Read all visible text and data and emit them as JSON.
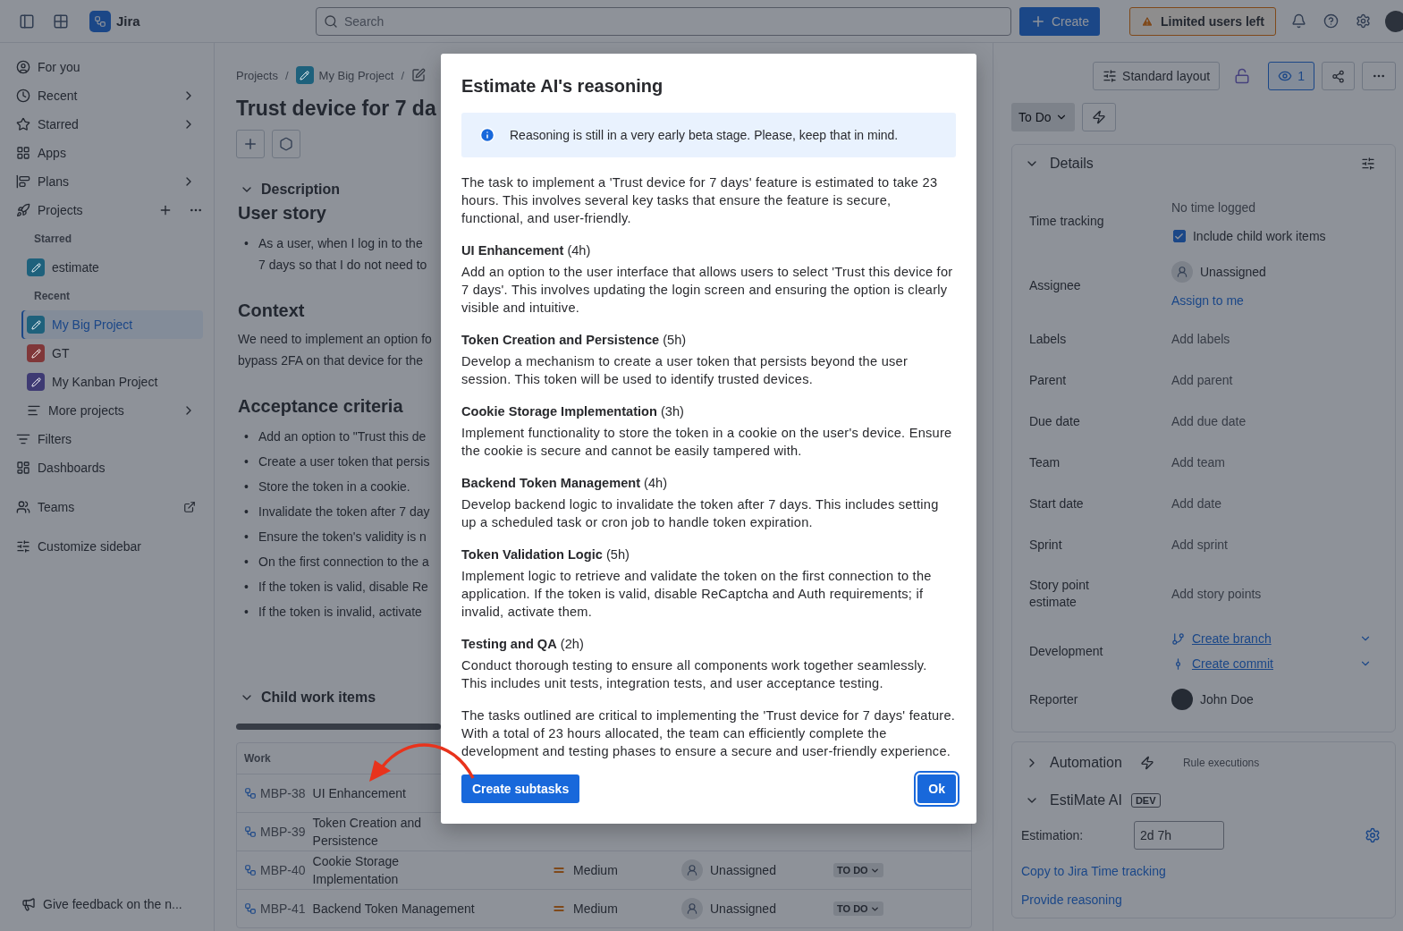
{
  "topbar": {
    "app_name": "Jira",
    "search": {
      "placeholder": "Search"
    },
    "create_button": "Create",
    "warning_button": "Limited users left"
  },
  "sidebar": {
    "items": [
      {
        "kind": "link",
        "label": "For you",
        "chevron": false,
        "selected": false
      },
      {
        "kind": "link",
        "label": "Recent",
        "chevron": true,
        "selected": false
      },
      {
        "kind": "link",
        "label": "Starred",
        "chevron": true,
        "selected": false
      },
      {
        "kind": "link",
        "label": "Apps",
        "chevron": false,
        "selected": false
      },
      {
        "kind": "link",
        "label": "Plans",
        "chevron": true,
        "selected": false
      },
      {
        "kind": "group",
        "label": "Projects",
        "chevron": false,
        "selected": false,
        "children": [
          {
            "kind": "heading",
            "label": "Starred"
          },
          {
            "kind": "project",
            "label": "estimate",
            "color": "#1e617c",
            "selected": false
          },
          {
            "kind": "heading",
            "label": "Recent"
          },
          {
            "kind": "project",
            "label": "My Big Project",
            "color": "#1e617c",
            "selected": true
          },
          {
            "kind": "project",
            "label": "GT",
            "color": "#803739",
            "selected": false
          },
          {
            "kind": "project",
            "label": "My Kanban Project",
            "color": "#3e3a73",
            "selected": false
          },
          {
            "kind": "link",
            "label": "More projects",
            "chevron": true,
            "selected": false
          }
        ]
      },
      {
        "kind": "link",
        "label": "Filters",
        "chevron": false,
        "selected": false
      },
      {
        "kind": "link",
        "label": "Dashboards",
        "chevron": false,
        "selected": false
      },
      {
        "kind": "external",
        "label": "Teams",
        "chevron": false,
        "selected": false
      },
      {
        "kind": "link",
        "label": "Customize sidebar",
        "chevron": false,
        "selected": false
      }
    ],
    "feedback": "Give feedback on the n..."
  },
  "main": {
    "breadcrumbs": [
      {
        "label": "Projects",
        "separator": "/"
      },
      {
        "label": "My Big Project",
        "separator": "/"
      }
    ],
    "title": "Trust device for 7 da",
    "description": {
      "heading": "Description",
      "expanded": true,
      "blocks": [
        {
          "kind": "heading",
          "text": "User story"
        },
        {
          "kind": "bullets",
          "marker": "•",
          "items": [
            {
              "lines": [
                "As a user, when I log in to the",
                "7 days so that I do not need to"
              ]
            }
          ]
        },
        {
          "kind": "heading",
          "text": "Context"
        },
        {
          "kind": "paragraph",
          "lines": [
            "We need to implement an option fo",
            "bypass 2FA on that device for the"
          ]
        },
        {
          "kind": "heading",
          "text": "Acceptance criteria"
        },
        {
          "kind": "bullets",
          "marker": "•",
          "items": [
            {
              "lines": [
                "Add an option to \"Trust this de"
              ]
            },
            {
              "lines": [
                "Create a user token that persis"
              ]
            },
            {
              "lines": [
                "Store the token in a cookie."
              ]
            },
            {
              "lines": [
                "Invalidate the token after 7 day"
              ]
            },
            {
              "lines": [
                "Ensure the token's validity is n"
              ]
            },
            {
              "lines": [
                "On the first connection to the a"
              ]
            },
            {
              "lines": [
                "If the token is valid, disable Re"
              ]
            },
            {
              "lines": [
                "If the token is invalid, activate"
              ]
            }
          ]
        }
      ]
    },
    "child_items": {
      "heading": "Child work items",
      "expanded": true,
      "progress": {
        "level": 0
      },
      "columns": [
        "Work"
      ],
      "rows": [
        {
          "key": "MBP-38",
          "summary": "UI Enhancement"
        },
        {
          "key": "MBP-39",
          "summary": "Token Creation and Persistence"
        },
        {
          "key": "MBP-40",
          "summary": "Cookie Storage Implementation",
          "priority": "Medium",
          "assignee": "Unassigned",
          "status": "TO DO"
        },
        {
          "key": "MBP-41",
          "summary": "Backend Token Management",
          "priority": "Medium",
          "assignee": "Unassigned",
          "status": "TO DO"
        }
      ]
    }
  },
  "right_panel": {
    "layout_button": "Standard layout",
    "watch": {
      "count": "1",
      "selected": true
    },
    "status": "To Do",
    "details": {
      "title": "Details",
      "expanded": true,
      "fields": [
        {
          "kind": "time",
          "label": "Time tracking",
          "value": "No time logged",
          "checkbox": {
            "label": "Include child work items",
            "checked": true
          }
        },
        {
          "kind": "person",
          "label": "Assignee",
          "value": "Unassigned",
          "link": "Assign to me"
        },
        {
          "kind": "text",
          "label": "Labels",
          "value": "Add labels"
        },
        {
          "kind": "text",
          "label": "Parent",
          "value": "Add parent"
        },
        {
          "kind": "text",
          "label": "Due date",
          "value": "Add due date"
        },
        {
          "kind": "text",
          "label": "Team",
          "value": "Add team"
        },
        {
          "kind": "text",
          "label": "Start date",
          "value": "Add date"
        },
        {
          "kind": "text",
          "label": "Sprint",
          "value": "Add sprint"
        },
        {
          "kind": "text",
          "label": "Story point estimate",
          "value": "Add story points"
        },
        {
          "kind": "dev",
          "label": "Development",
          "links": [
            "Create branch",
            "Create commit"
          ]
        },
        {
          "kind": "reporter",
          "label": "Reporter",
          "value": "John Doe"
        }
      ]
    },
    "automation": {
      "title": "Automation",
      "subtitle": "Rule executions",
      "expanded": false
    },
    "estimate": {
      "title": "EstiMate AI",
      "badge": "DEV",
      "expanded": true,
      "label": "Estimation:",
      "value": "2d 7h",
      "links": [
        "Copy to Jira Time tracking",
        "Provide reasoning"
      ]
    }
  },
  "modal": {
    "title": "Estimate AI's reasoning",
    "info": "Reasoning is still in a very early beta stage. Please, keep that in mind.",
    "intro": "The task to implement a 'Trust device for 7 days' feature is estimated to take 23 hours. This involves several key tasks that ensure the feature is secure, functional, and user-friendly.",
    "sections": [
      {
        "heading": "**UI Enhancement** (4h)",
        "body": "Add an option to the user interface that allows users to select 'Trust this device for 7 days'. This involves updating the login screen and ensuring the option is clearly visible and intuitive."
      },
      {
        "heading": "**Token Creation and Persistence** (5h)",
        "body": "Develop a mechanism to create a user token that persists beyond the user session. This token will be used to identify trusted devices."
      },
      {
        "heading": "**Cookie Storage Implementation** (3h)",
        "body": "Implement functionality to store the token in a cookie on the user's device. Ensure the cookie is secure and cannot be easily tampered with."
      },
      {
        "heading": "**Backend Token Management** (4h)",
        "body": "Develop backend logic to invalidate the token after 7 days. This includes setting up a scheduled task or cron job to handle token expiration."
      },
      {
        "heading": "**Token Validation Logic** (5h)",
        "body": "Implement logic to retrieve and validate the token on the first connection to the application. If the token is valid, disable ReCaptcha and Auth requirements; if invalid, activate them."
      },
      {
        "heading": "**Testing and QA** (2h)",
        "body": "Conduct thorough testing to ensure all components work together seamlessly. This includes unit tests, integration tests, and user acceptance testing."
      }
    ],
    "conclusion": "The tasks outlined are critical to implementing the 'Trust device for 7 days' feature. With a total of 23 hours allocated, the team can efficiently complete the development and testing phases to ensure a secure and user-friendly experience.",
    "primary_button": "Create subtasks",
    "ok_button": "Ok"
  }
}
